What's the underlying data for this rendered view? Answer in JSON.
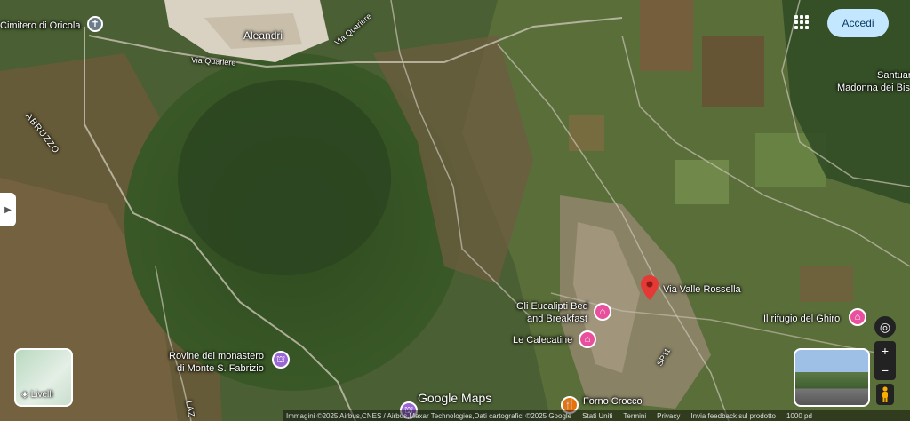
{
  "header": {
    "signin_label": "Accedi",
    "apps_icon": "apps-grid-icon"
  },
  "places": {
    "cimitero": "Cimitero di Oricola",
    "aleandri": "Aleandri",
    "via_quariere_1": "Via Quariere",
    "via_quariere_2": "Via Quariere",
    "abruzzo": "ABRUZZO",
    "santuario_1": "Santuar",
    "santuario_2": "Madonna dei Bis",
    "via_valle_rossella": "Via Valle Rossella",
    "gli_eucalipti_1": "Gli Eucalipti Bed",
    "gli_eucalipti_2": "and Breakfast",
    "le_calecatine": "Le Calecatine",
    "rifugio": "Il rifugio del Ghiro",
    "rovine_1": "Rovine del monastero",
    "rovine_2": "di Monte S. Fabrizio",
    "forno": "Forno Crocco",
    "sp": "SP11",
    "laz": "LAZ"
  },
  "controls": {
    "layers_label": "Livelli",
    "zoom_in": "+",
    "zoom_out": "−",
    "logo": "Google Maps"
  },
  "footer": {
    "imagery": "Immagini ©2025 Airbus,CNES / Airbus,Maxar Technologies,Dati cartografici ©2025 Google",
    "country": "Stati Uniti",
    "terms": "Termini",
    "privacy": "Privacy",
    "feedback": "Invia feedback sul prodotto",
    "scale": "1000 pd"
  },
  "colors": {
    "pin_red": "#e53935",
    "hotel_pink": "#e84f9c",
    "attraction_purple": "#9b67d6",
    "food_orange": "#e8710a",
    "signin_bg": "#c2e7ff"
  }
}
